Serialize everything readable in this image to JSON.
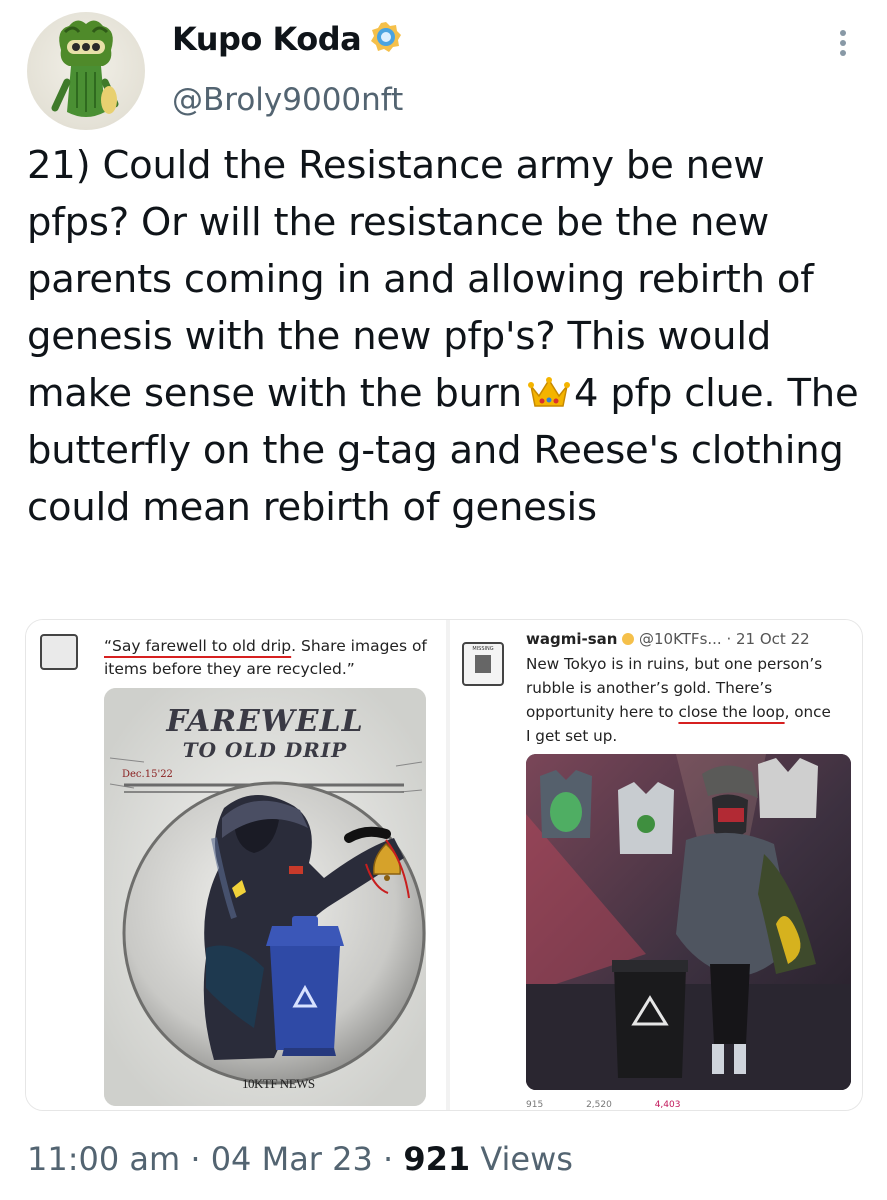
{
  "author": {
    "display_name": "Kupo Koda",
    "handle": "@Broly9000nft",
    "verified_badge_icon": "verified-badge-icon"
  },
  "tweet": {
    "text_before_emoji": "21) Could the Resistance army be new pfps? Or will the resistance be the new parents coming in and allowing rebirth of genesis with the new pfp's? This would make sense with the burn",
    "emoji_icon": "crown-icon",
    "text_after_emoji": "4 pfp clue. The butterfly on the g-tag and Reese's clothing could mean rebirth of genesis"
  },
  "media": {
    "left": {
      "quote_line1_underlined": "“Say farewell to old drip",
      "quote_line1_rest": ". Share images of",
      "quote_line2": "items before they are recycled.”",
      "poster_title_line1": "FAREWELL",
      "poster_title_line2": "TO OLD DRIP",
      "poster_date": "Dec.15'22",
      "poster_footer": "10KTF NEWS"
    },
    "right": {
      "header_name": "wagmi-san",
      "header_handle": "@10KTFs...",
      "header_date": "· 21 Oct 22",
      "avatar_label": "MISSING",
      "line1": "New Tokyo is in ruins, but one person’s",
      "line2": "rubble is another’s gold. There’s",
      "line3_before": "opportunity here to ",
      "line3_underlined": "close the loop",
      "line3_after": ", once",
      "line4": "I get set up.",
      "stat_replies": "915",
      "stat_retweets": "2,520",
      "stat_likes": "4,403"
    }
  },
  "footer": {
    "time": "11:00 am",
    "sep1": "·",
    "date": "04 Mar 23",
    "sep2": "·",
    "views_count": "921",
    "views_label": "Views"
  },
  "colors": {
    "text": "#0f1419",
    "secondary": "#536471",
    "underline_red": "#d62020",
    "badge_gold": "#f5c04a",
    "badge_blue": "#4aa3e0"
  }
}
